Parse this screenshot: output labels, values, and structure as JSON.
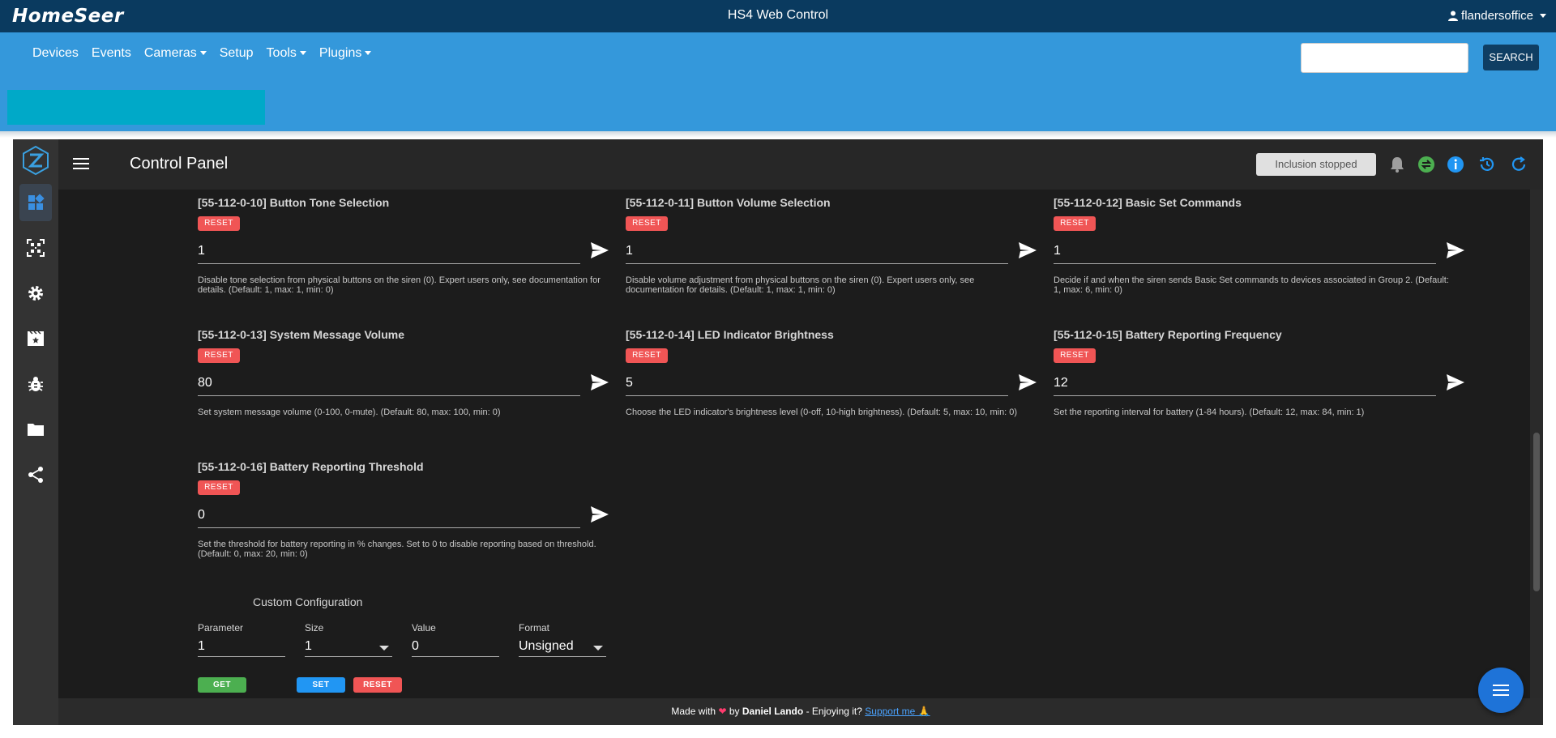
{
  "header": {
    "logo": "HomeSeer",
    "title": "HS4 Web Control",
    "user": "flandersoffice"
  },
  "nav": {
    "items": [
      "Devices",
      "Events",
      "Cameras",
      "Setup",
      "Tools",
      "Plugins"
    ],
    "search_placeholder": "",
    "search_label": "SEARCH"
  },
  "panel": {
    "title": "Control Panel",
    "inclusion_status": "Inclusion stopped"
  },
  "params": [
    {
      "title": "[55-112-0-10] Button Tone Selection",
      "reset": "RESET",
      "value": "1",
      "desc": "Disable tone selection from physical buttons on the siren (0). Expert users only, see documentation for details. (Default: 1, max: 1, min: 0)"
    },
    {
      "title": "[55-112-0-11] Button Volume Selection",
      "reset": "RESET",
      "value": "1",
      "desc": "Disable volume adjustment from physical buttons on the siren (0). Expert users only, see documentation for details. (Default: 1, max: 1, min: 0)"
    },
    {
      "title": "[55-112-0-12] Basic Set Commands",
      "reset": "RESET",
      "value": "1",
      "desc": "Decide if and when the siren sends Basic Set commands to devices associated in Group 2. (Default: 1, max: 6, min: 0)"
    },
    {
      "title": "[55-112-0-13] System Message Volume",
      "reset": "RESET",
      "value": "80",
      "desc": "Set system message volume (0-100, 0-mute). (Default: 80, max: 100, min: 0)"
    },
    {
      "title": "[55-112-0-14] LED Indicator Brightness",
      "reset": "RESET",
      "value": "5",
      "desc": "Choose the LED indicator's brightness level (0-off, 10-high brightness). (Default: 5, max: 10, min: 0)"
    },
    {
      "title": "[55-112-0-15] Battery Reporting Frequency",
      "reset": "RESET",
      "value": "12",
      "desc": "Set the reporting interval for battery (1-84 hours). (Default: 12, max: 84, min: 1)"
    },
    {
      "title": "[55-112-0-16] Battery Reporting Threshold",
      "reset": "RESET",
      "value": "0",
      "desc": "Set the threshold for battery reporting in % changes. Set to 0 to disable reporting based on threshold. (Default: 0, max: 20, min: 0)"
    }
  ],
  "custom": {
    "title": "Custom Configuration",
    "parameter_label": "Parameter",
    "parameter_value": "1",
    "size_label": "Size",
    "size_value": "1",
    "value_label": "Value",
    "value_value": "0",
    "format_label": "Format",
    "format_value": "Unsigned",
    "get_label": "GET",
    "set_label": "SET",
    "reset_label": "RESET"
  },
  "footer": {
    "made_with": "Made with",
    "by": "by",
    "author": "Daniel Lando",
    "enjoying": "- Enjoying it?",
    "support": "Support me 🙏"
  },
  "colors": {
    "topbar": "#0a3a5f",
    "navbar": "#3498db",
    "reset": "#f05555",
    "get": "#4caf50",
    "set": "#2196f3",
    "fab": "#1e73d8"
  },
  "icons": {
    "left_nav": [
      "dashboard-icon",
      "qr-scan-icon",
      "settings-icon",
      "scenes-icon",
      "debug-icon",
      "folder-icon",
      "share-icon"
    ],
    "toolbar": [
      "bell-icon",
      "sync-icon",
      "info-icon",
      "history-icon",
      "refresh-icon"
    ]
  }
}
